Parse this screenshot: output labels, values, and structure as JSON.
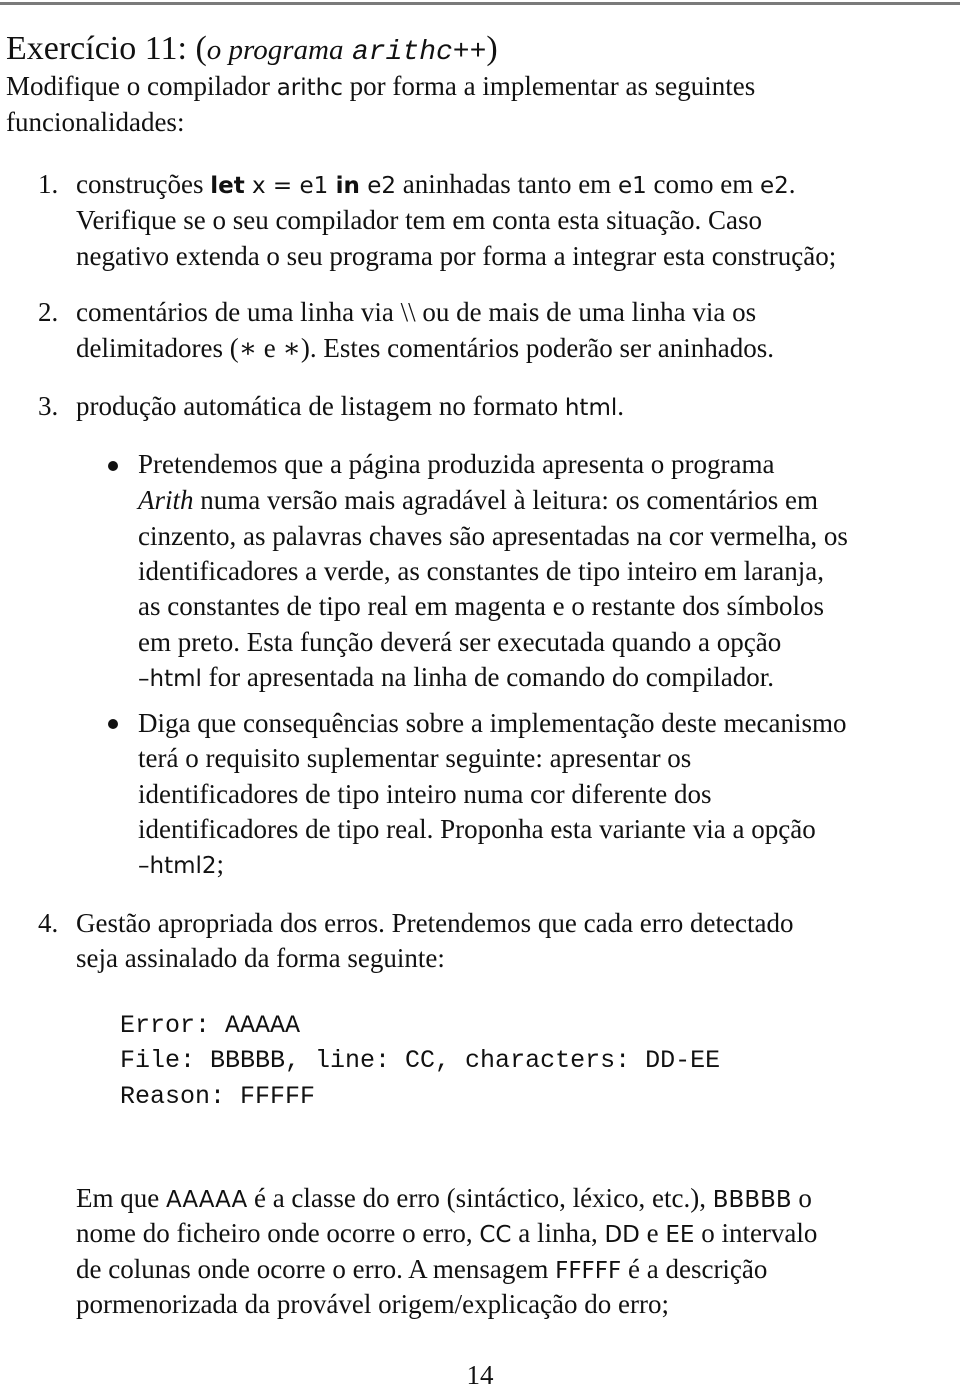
{
  "header": {
    "exercise_label": "Exercício 11:",
    "paren_open": "(",
    "subtitle_italic": "o programa",
    "program_name": "arithc++",
    "paren_close": ")"
  },
  "intro": {
    "line1_a": "Modifique o compilador ",
    "line1_code": "arithc",
    "line1_b": " por forma a implementar as seguintes",
    "line2": "funcionalidades:"
  },
  "items": [
    {
      "number": "1.",
      "l1_a": "construções ",
      "l1_kw1": "let",
      "l1_b": " x = e1 ",
      "l1_kw2": "in",
      "l1_c": " e2",
      "l1_d": " aninhadas tanto em ",
      "l1_e": "e1",
      "l1_f": " como em ",
      "l1_g": "e2",
      "l1_h": ".",
      "l2": "Verifique se o seu compilador tem em conta esta situação. Caso",
      "l3": "negativo extenda o seu programa por forma a integrar esta construção;"
    },
    {
      "number": "2.",
      "l1": "comentários de uma linha via \\\\ ou de mais de uma linha via os",
      "l2": "delimitadores (∗ e ∗). Estes comentários poderão ser aninhados."
    },
    {
      "number": "3.",
      "l1_a": "produção automática de listagem no formato ",
      "l1_code": "html",
      "l1_b": "."
    },
    {
      "number": "4.",
      "l1": "Gestão apropriada dos erros. Pretendemos que cada erro detectado",
      "l2": "seja assinalado da forma seguinte:"
    }
  ],
  "bullets": [
    {
      "l1": "Pretendemos que a página produzida apresenta o programa",
      "l2_italic": "Arith",
      "l2_rest": " numa versão mais agradável à leitura: os comentários em",
      "l3": "cinzento, as palavras chaves são apresentadas na cor vermelha, os",
      "l4": "identificadores a verde, as constantes de tipo inteiro em laranja,",
      "l5": "as constantes de tipo real em magenta e o restante dos símbolos",
      "l6": "em preto. Esta função deverá ser executada quando a opção",
      "l7_code": "–html",
      "l7_rest": " for apresentada na linha de comando do compilador."
    },
    {
      "l1": "Diga que consequências sobre a implementação deste mecanismo",
      "l2": "terá o requisito suplementar seguinte: apresentar os",
      "l3": "identificadores de tipo inteiro numa cor diferente dos",
      "l4": "identificadores de tipo real. Proponha esta variante via a opção",
      "l5_code": "–html2",
      "l5_rest": ";"
    }
  ],
  "error_format": [
    "Error: AAAAA",
    "File: BBBBB, line: CC, characters: DD-EE",
    "Reason: FFFFF"
  ],
  "explanation": {
    "l1_a": "Em que ",
    "l1_c1": "AAAAA",
    "l1_b": " é a classe do erro (sintáctico, léxico, etc.), ",
    "l1_c2": "BBBBB",
    "l1_c": " o",
    "l2_a": "nome do ficheiro onde ocorre o erro, ",
    "l2_c1": "CC",
    "l2_b": " a linha, ",
    "l2_c2": "DD",
    "l2_c": " e ",
    "l2_c3": "EE",
    "l2_d": " o intervalo",
    "l3_a": "de colunas onde ocorre o erro. A mensagem ",
    "l3_c1": "FFFFF",
    "l3_b": " é a descrição",
    "l4": "pormenorizada da provável origem/explicação do erro;"
  },
  "footer": {
    "page_number": "14"
  }
}
